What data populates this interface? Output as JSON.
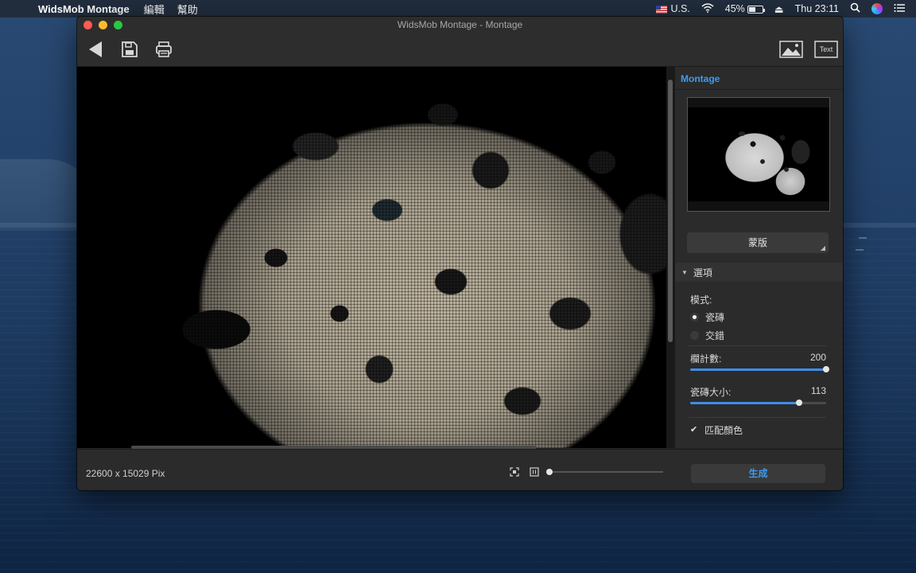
{
  "menubar": {
    "app_name": "WidsMob Montage",
    "menus": [
      "編輯",
      "幫助"
    ],
    "input_source": "U.S.",
    "battery_percent": "45%",
    "clock": "Thu 23:11"
  },
  "window": {
    "title": "WidsMob Montage - Montage"
  },
  "toolbar": {
    "text_button_label": "Text"
  },
  "panel": {
    "title": "Montage",
    "mask_button_label": "蒙版",
    "options_section_label": "選項",
    "mode_label": "模式:",
    "mode_options": [
      {
        "label": "瓷磚",
        "selected": true
      },
      {
        "label": "交錯",
        "selected": false
      }
    ],
    "columns": {
      "label": "欄計數:",
      "value": "200",
      "fraction": 1.0
    },
    "tile_size": {
      "label": "瓷磚大小:",
      "value": "113",
      "fraction": 0.8
    },
    "match_color": {
      "label": "匹配顏色",
      "checked": true
    }
  },
  "statusbar": {
    "dimensions": "22600 x 15029 Pix",
    "zoom_fraction": 0.0,
    "generate_label": "生成"
  },
  "colors": {
    "accent": "#3d9bf0",
    "window_bg": "#262626",
    "panel_bg": "#2b2b2b"
  }
}
